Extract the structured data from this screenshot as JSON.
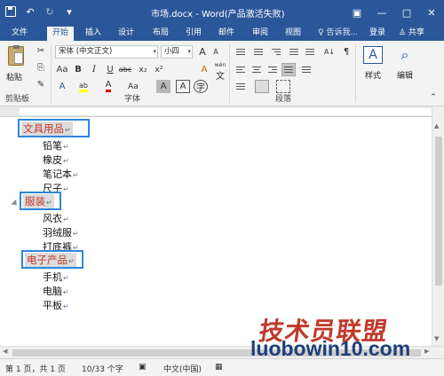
{
  "titlebar": {
    "title": "市场.docx - Word(产品激活失败)",
    "undo_glyph": "↶",
    "redo_glyph": "↻",
    "customize_glyph": "▾",
    "restore_glyph": "▣",
    "minimize_glyph": "—",
    "maximize_glyph": "□",
    "close_glyph": "✕"
  },
  "tabs": [
    {
      "label": "文件"
    },
    {
      "label": "开始"
    },
    {
      "label": "插入"
    },
    {
      "label": "设计"
    },
    {
      "label": "布局"
    },
    {
      "label": "引用"
    },
    {
      "label": "邮件"
    },
    {
      "label": "审阅"
    },
    {
      "label": "视图"
    }
  ],
  "tellme": "♀ 告诉我...",
  "login": "登录",
  "share": "♙ 共享",
  "ribbon": {
    "clipboard": {
      "paste_label": "粘贴",
      "group": "剪贴板",
      "cut_glyph": "✂",
      "copy_glyph": "⎘",
      "painter_glyph": "✎"
    },
    "font": {
      "font_name": "宋体 (中文正文)",
      "font_size": "小四",
      "grow": "A",
      "shrink": "A",
      "case": "Aa",
      "clear": "A",
      "wen": "wén",
      "wen_glyph": "文",
      "bold": "B",
      "italic": "I",
      "underline": "U",
      "strike": "abc",
      "sub": "x₂",
      "sup": "x²",
      "effects": "A",
      "highlight": "ab",
      "color": "A",
      "case2": "Aa",
      "shading": "A",
      "border": "A",
      "enclose": "字",
      "group": "字体"
    },
    "paragraph": {
      "group": "段落",
      "sort": "A↓",
      "marks": "¶"
    },
    "styles": {
      "label": "样式",
      "glyph": "A"
    },
    "editing": {
      "label": "编辑",
      "glyph": "⌕"
    },
    "collapse_glyph": "⌃",
    "colors": {
      "highlight": "#ffff00",
      "font_color": "#e00000"
    }
  },
  "document": {
    "headings": [
      {
        "text": "文具用品",
        "items": [
          "铅笔",
          "橡皮",
          "笔记本",
          "尺子"
        ]
      },
      {
        "text": "服装",
        "items": [
          "风衣",
          "羽绒服",
          "打底裤"
        ]
      },
      {
        "text": "电子产品",
        "items": [
          "手机",
          "电脑",
          "平板"
        ]
      }
    ],
    "para_mark": "↵"
  },
  "statusbar": {
    "page": "第 1 页，共 1 页",
    "words": "10/33 个字",
    "lang": "中文(中国)"
  },
  "scroll_glyphs": {
    "up": "▲",
    "down": "▼",
    "left": "◀",
    "right": "▶"
  },
  "watermark": {
    "cn": "技术员联盟",
    "en": "luobowin10.com"
  },
  "colors": {
    "title_bar": "#2b579a",
    "heading_text": "#c0392b",
    "annotation_box": "#2e86de"
  }
}
